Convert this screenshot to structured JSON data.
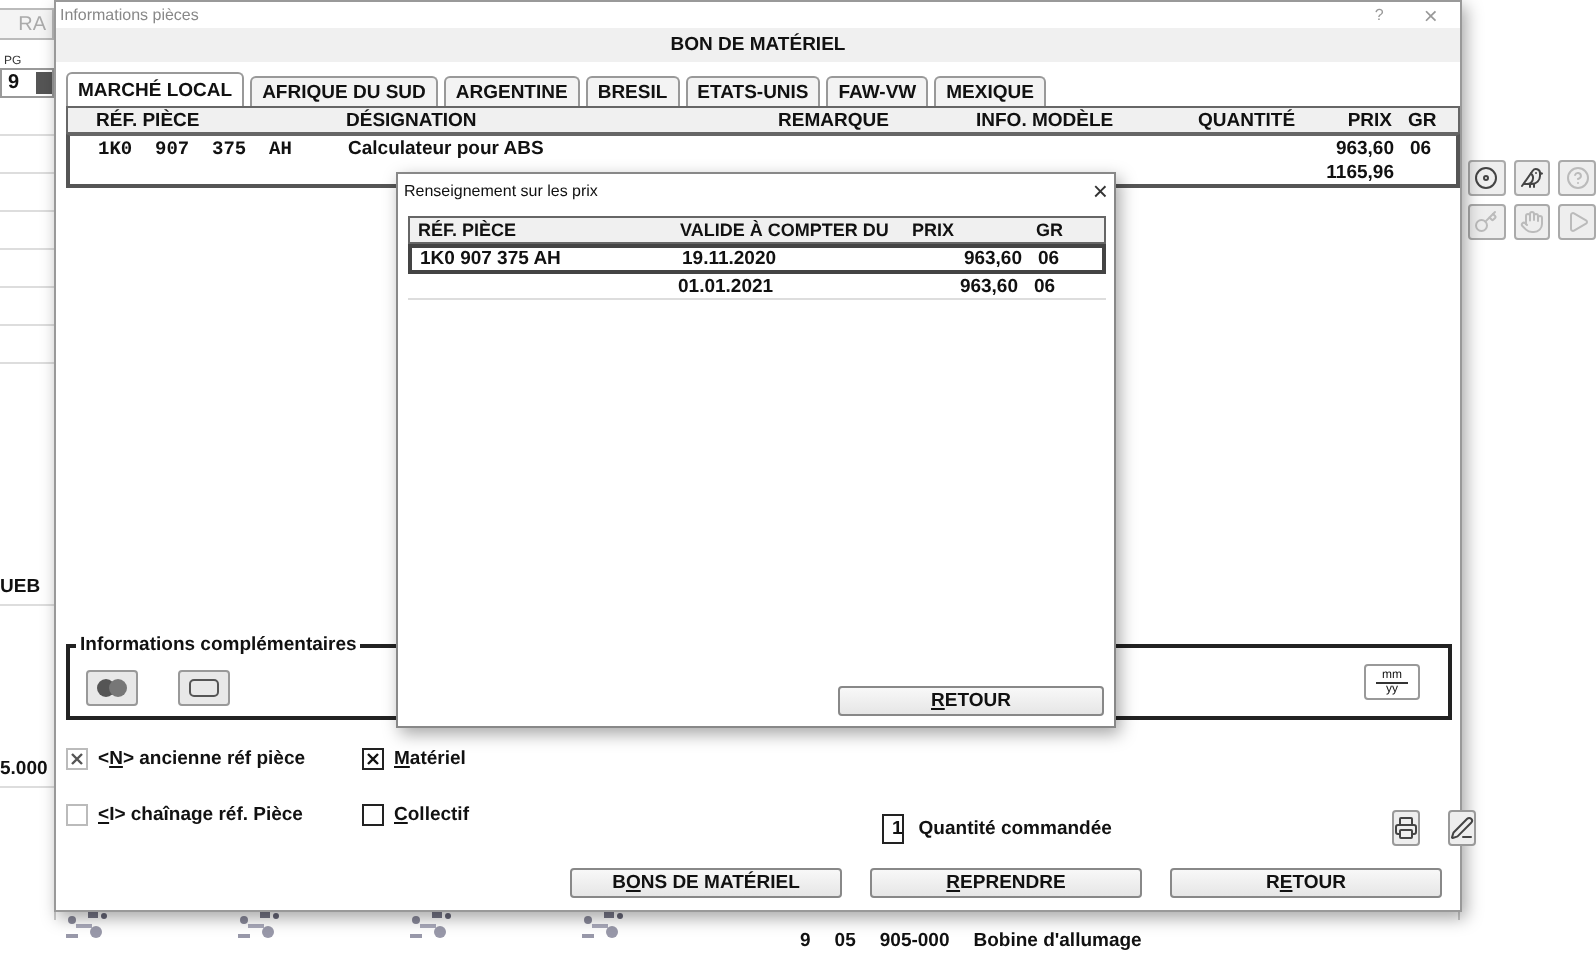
{
  "background_app": {
    "tab": "RA",
    "select_label": "PG",
    "select_value": "9",
    "cells": [
      "UEB",
      "5.000"
    ],
    "list_row": [
      "9",
      "05",
      "905-000",
      "Bobine d'allumage"
    ]
  },
  "window": {
    "title": "Informations pièces",
    "help": "?",
    "close": "×",
    "heading": "BON DE MATÉRIEL"
  },
  "tabs": [
    {
      "label": "MARCHÉ LOCAL",
      "selected": true
    },
    {
      "label": "AFRIQUE DU SUD",
      "selected": false
    },
    {
      "label": "ARGENTINE",
      "selected": false
    },
    {
      "label": "BRESIL",
      "selected": false
    },
    {
      "label": "ETATS-UNIS",
      "selected": false
    },
    {
      "label": "FAW-VW",
      "selected": false
    },
    {
      "label": "MEXIQUE",
      "selected": false
    }
  ],
  "table": {
    "columns": [
      "RÉF. PIÈCE",
      "DÉSIGNATION",
      "REMARQUE",
      "INFO. MODÈLE",
      "QUANTITÉ",
      "PRIX",
      "GR"
    ],
    "rows": [
      {
        "ref": "1K0  907  375  AH",
        "designation": "Calculateur pour ABS",
        "price": "963,60",
        "gr": "06",
        "total": "1165,96"
      }
    ]
  },
  "info_group": {
    "title": "Informations complémentaires",
    "date_button": {
      "top": "mm",
      "bottom": "yy"
    }
  },
  "options": [
    {
      "pre": "<",
      "key": "N",
      "post": "> ancienne réf pièce",
      "checked": true,
      "disabled": true
    },
    {
      "key": "M",
      "post": "atériel",
      "checked": true,
      "disabled": false
    },
    {
      "key": "<",
      "post": "I> chaînage réf. Pièce",
      "checked": false,
      "disabled": true
    },
    {
      "key": "C",
      "post": "ollectif",
      "checked": false,
      "disabled": false
    }
  ],
  "quantity": {
    "value": "1",
    "label": "Quantité commandée"
  },
  "buttons": [
    {
      "pre": "B",
      "key": "O",
      "post": "NS DE MATÉRIEL"
    },
    {
      "key": "R",
      "post": "EPRENDRE"
    },
    {
      "pre": "R",
      "key": "E",
      "post": "TOUR"
    }
  ],
  "dialog": {
    "title": "Renseignement sur les prix",
    "close": "×",
    "columns": [
      "RÉF. PIÈCE",
      "VALIDE À COMPTER DU",
      "PRIX",
      "GR"
    ],
    "rows": [
      {
        "ref": "1K0 907 375 AH",
        "valid_from": "19.11.2020",
        "price": "963,60",
        "gr": "06",
        "selected": true
      },
      {
        "valid_from": "01.01.2021",
        "price": "963,60",
        "gr": "06",
        "selected": false
      }
    ],
    "button": {
      "key": "R",
      "post": "ETOUR"
    }
  }
}
